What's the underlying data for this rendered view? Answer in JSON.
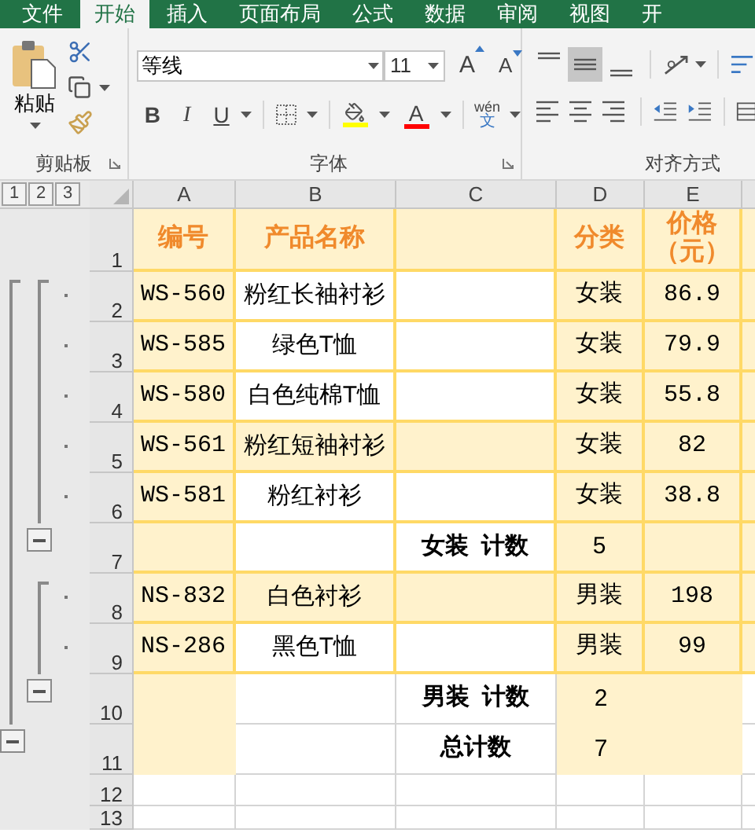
{
  "tabs": [
    {
      "label": "文件",
      "selected": false
    },
    {
      "label": "开始",
      "selected": true
    },
    {
      "label": "插入",
      "selected": false
    },
    {
      "label": "页面布局",
      "selected": false
    },
    {
      "label": "公式",
      "selected": false
    },
    {
      "label": "数据",
      "selected": false
    },
    {
      "label": "审阅",
      "selected": false
    },
    {
      "label": "视图",
      "selected": false
    },
    {
      "label": "开",
      "selected": false
    }
  ],
  "clipboard": {
    "paste_label": "粘贴",
    "group_label": "剪贴板"
  },
  "font": {
    "name": "等线",
    "size": "11",
    "grow": "A",
    "shrink": "A",
    "bold": "B",
    "italic": "I",
    "underline": "U",
    "font_color_letter": "A",
    "phonetic_top": "wén",
    "phonetic_bottom": "文",
    "group_label": "字体"
  },
  "alignment": {
    "vertical": [
      {
        "kind": "top",
        "selected": false
      },
      {
        "kind": "middle",
        "selected": true
      },
      {
        "kind": "bottom",
        "selected": false
      }
    ],
    "horizontal": [
      {
        "kind": "left",
        "selected": false
      },
      {
        "kind": "center",
        "selected": false
      },
      {
        "kind": "right",
        "selected": false
      }
    ],
    "group_label": "对齐方式"
  },
  "outline_levels": [
    "1",
    "2",
    "3"
  ],
  "columns": [
    {
      "label": "A",
      "shaded": true
    },
    {
      "label": "B",
      "shaded": false
    },
    {
      "label": "C",
      "shaded": false
    },
    {
      "label": "D",
      "shaded": true
    },
    {
      "label": "E",
      "shaded": true
    }
  ],
  "rows": [
    {
      "number": "1",
      "kind": "header",
      "shaded": true,
      "bordered": true,
      "outline": [
        {
          "kind": "none"
        },
        {
          "kind": "none"
        },
        {
          "kind": "none"
        }
      ],
      "cells": [
        "编号",
        "产品名称",
        null,
        "分类",
        "价格（元）"
      ]
    },
    {
      "number": "2",
      "kind": "data",
      "shaded": false,
      "bordered": true,
      "outline": [
        {
          "kind": "top"
        },
        {
          "kind": "top"
        },
        {
          "kind": "dot"
        }
      ],
      "cells": [
        "WS-560",
        "粉红长袖衬衫",
        null,
        "女装",
        "86.9"
      ]
    },
    {
      "number": "3",
      "kind": "data",
      "shaded": false,
      "bordered": true,
      "outline": [
        {
          "kind": "line"
        },
        {
          "kind": "line"
        },
        {
          "kind": "dot"
        }
      ],
      "cells": [
        "WS-585",
        "绿色T恤",
        null,
        "女装",
        "79.9"
      ]
    },
    {
      "number": "4",
      "kind": "data",
      "shaded": false,
      "bordered": true,
      "outline": [
        {
          "kind": "line"
        },
        {
          "kind": "line"
        },
        {
          "kind": "dot"
        }
      ],
      "cells": [
        "WS-580",
        "白色纯棉T恤",
        null,
        "女装",
        "55.8"
      ]
    },
    {
      "number": "5",
      "kind": "data",
      "shaded": true,
      "bordered": true,
      "outline": [
        {
          "kind": "line"
        },
        {
          "kind": "line"
        },
        {
          "kind": "dot"
        }
      ],
      "cells": [
        "WS-561",
        "粉红短袖衬衫",
        null,
        "女装",
        "82"
      ]
    },
    {
      "number": "6",
      "kind": "data",
      "shaded": false,
      "bordered": true,
      "outline": [
        {
          "kind": "line"
        },
        {
          "kind": "line"
        },
        {
          "kind": "dot"
        }
      ],
      "cells": [
        "WS-581",
        "粉红衬衫",
        null,
        "女装",
        "38.8"
      ]
    },
    {
      "number": "7",
      "kind": "subtotal",
      "shaded": false,
      "bordered": true,
      "outline": [
        {
          "kind": "line"
        },
        {
          "kind": "minus"
        },
        {
          "kind": "none"
        }
      ],
      "cells": [
        null,
        null,
        "女装  计数",
        "5",
        null
      ]
    },
    {
      "number": "8",
      "kind": "data",
      "shaded": true,
      "bordered": true,
      "outline": [
        {
          "kind": "line"
        },
        {
          "kind": "top"
        },
        {
          "kind": "dot"
        }
      ],
      "cells": [
        "NS-832",
        "白色衬衫",
        null,
        "男装",
        "198"
      ]
    },
    {
      "number": "9",
      "kind": "data",
      "shaded": false,
      "bordered": true,
      "outline": [
        {
          "kind": "line"
        },
        {
          "kind": "line"
        },
        {
          "kind": "dot"
        }
      ],
      "cells": [
        "NS-286",
        "黑色T恤",
        null,
        "男装",
        "99"
      ]
    },
    {
      "number": "10",
      "kind": "subtotal",
      "shaded": false,
      "bordered": false,
      "outline": [
        {
          "kind": "line"
        },
        {
          "kind": "minus"
        },
        {
          "kind": "none"
        }
      ],
      "cells": [
        null,
        null,
        "男装  计数",
        "2",
        null
      ]
    },
    {
      "number": "11",
      "kind": "subtotal",
      "shaded": false,
      "bordered": false,
      "outline": [
        {
          "kind": "minus"
        },
        {
          "kind": "none"
        },
        {
          "kind": "none"
        }
      ],
      "cells": [
        null,
        null,
        "总计数",
        "7",
        null
      ]
    },
    {
      "number": "12",
      "kind": "blank",
      "shaded": false,
      "bordered": false,
      "outline": [
        {
          "kind": "none"
        },
        {
          "kind": "none"
        },
        {
          "kind": "none"
        }
      ],
      "cells": [
        null,
        null,
        null,
        null,
        null
      ]
    },
    {
      "number": "13",
      "kind": "blank",
      "shaded": false,
      "bordered": false,
      "outline": [
        {
          "kind": "none"
        },
        {
          "kind": "none"
        },
        {
          "kind": "none"
        }
      ],
      "cells": [
        null,
        null,
        null,
        null,
        null
      ]
    }
  ]
}
